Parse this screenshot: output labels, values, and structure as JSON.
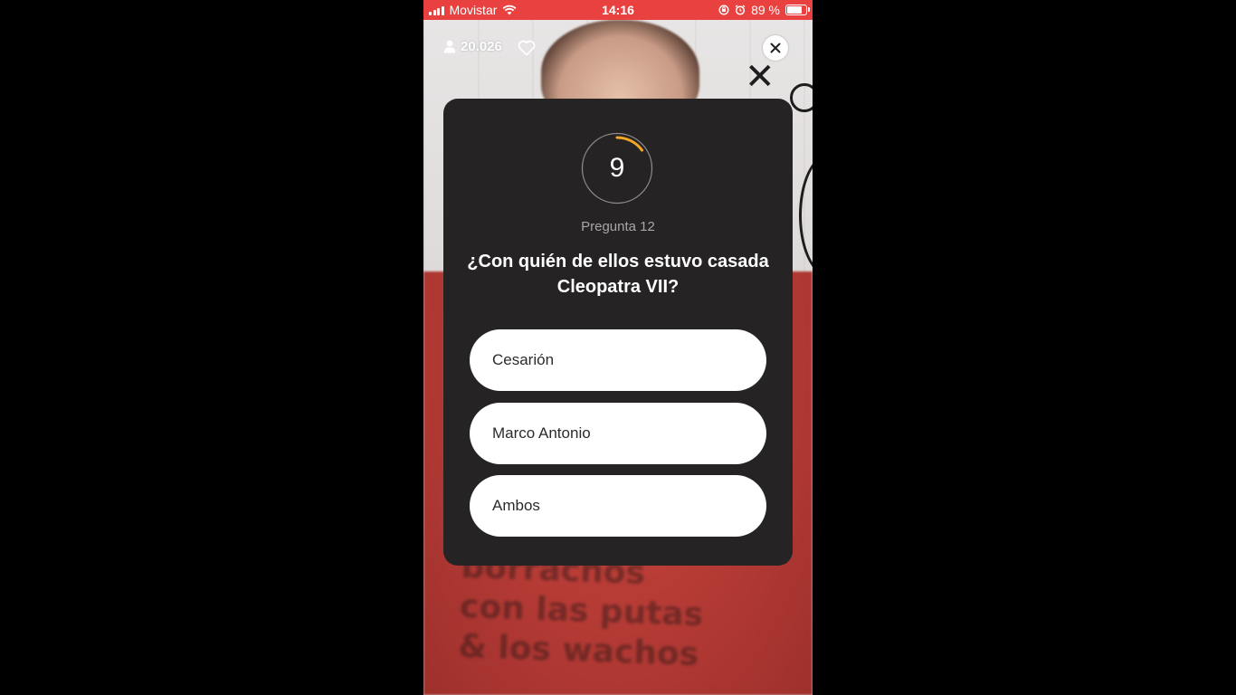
{
  "status_bar": {
    "carrier": "Movistar",
    "time": "14:16",
    "battery_percent": "89 %",
    "battery_level": 0.89,
    "background_color": "#e8413f"
  },
  "stream": {
    "viewer_count": "20.026",
    "viewer_icon": "person-icon",
    "like_icon": "heart-outline-icon",
    "close_icon": "close-icon",
    "background_text": "borrachos\ncon las putas\n& los wachos"
  },
  "quiz": {
    "timer_value": "9",
    "timer_progress": 0.15,
    "timer_color": "#f5a623",
    "question_label": "Pregunta 12",
    "question_text": "¿Con quién de ellos estuvo casada Cleopatra VII?",
    "answers": [
      {
        "label": "Cesarión"
      },
      {
        "label": "Marco Antonio"
      },
      {
        "label": "Ambos"
      }
    ]
  }
}
